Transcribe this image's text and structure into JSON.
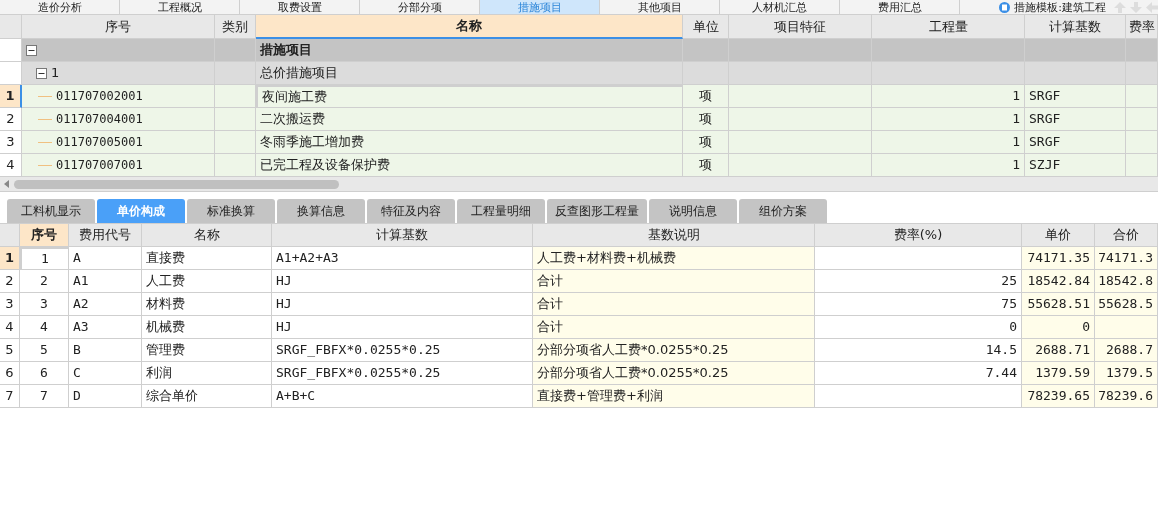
{
  "top_tabs": [
    {
      "label": "造价分析",
      "selected": false
    },
    {
      "label": "工程概况",
      "selected": false
    },
    {
      "label": "取费设置",
      "selected": false
    },
    {
      "label": "分部分项",
      "selected": false
    },
    {
      "label": "措施项目",
      "selected": true
    },
    {
      "label": "其他项目",
      "selected": false
    },
    {
      "label": "人材机汇总",
      "selected": false
    },
    {
      "label": "费用汇总",
      "selected": false
    }
  ],
  "template": "措施模板:建筑工程",
  "upper_table": {
    "columns": [
      {
        "label": "序号",
        "selected": false
      },
      {
        "label": "类别",
        "selected": false
      },
      {
        "label": "名称",
        "selected": true
      },
      {
        "label": "单位",
        "selected": false
      },
      {
        "label": "项目特征",
        "selected": false
      },
      {
        "label": "工程量",
        "selected": false
      },
      {
        "label": "计算基数",
        "selected": false
      },
      {
        "label": "费率",
        "selected": false
      }
    ],
    "rows": [
      {
        "name": "措施项目",
        "expanded": true,
        "children": [
          {
            "code": "1",
            "name": "总价措施项目",
            "expanded": true,
            "children": [
              {
                "row_number": "1",
                "code": "011707002001",
                "name": "夜间施工费",
                "unit": "项",
                "quantity": "1",
                "base": "SRGF",
                "selected": true
              },
              {
                "row_number": "2",
                "code": "011707004001",
                "name": "二次搬运费",
                "unit": "项",
                "quantity": "1",
                "base": "SRGF",
                "selected": false
              },
              {
                "row_number": "3",
                "code": "011707005001",
                "name": "冬雨季施工增加费",
                "unit": "项",
                "quantity": "1",
                "base": "SRGF",
                "selected": false
              },
              {
                "row_number": "4",
                "code": "011707007001",
                "name": "已完工程及设备保护费",
                "unit": "项",
                "quantity": "1",
                "base": "SZJF",
                "selected": false
              }
            ]
          }
        ]
      }
    ]
  },
  "bottom_tabs": [
    {
      "label": "工料机显示",
      "selected": false
    },
    {
      "label": "单价构成",
      "selected": true
    },
    {
      "label": "标准换算",
      "selected": false
    },
    {
      "label": "换算信息",
      "selected": false
    },
    {
      "label": "特征及内容",
      "selected": false
    },
    {
      "label": "工程量明细",
      "selected": false
    },
    {
      "label": "反查图形工程量",
      "selected": false
    },
    {
      "label": "说明信息",
      "selected": false
    },
    {
      "label": "组价方案",
      "selected": false
    }
  ],
  "lower_table": {
    "columns": [
      {
        "label": "序号",
        "selected": true
      },
      {
        "label": "费用代号",
        "selected": false
      },
      {
        "label": "名称",
        "selected": false
      },
      {
        "label": "计算基数",
        "selected": false
      },
      {
        "label": "基数说明",
        "selected": false
      },
      {
        "label": "费率(%)",
        "selected": false
      },
      {
        "label": "单价",
        "selected": false
      },
      {
        "label": "合价",
        "selected": false
      }
    ],
    "rows": [
      {
        "row_number": "1",
        "seq": "1",
        "code": "A",
        "name": "直接费",
        "base": "A1+A2+A3",
        "description": "人工费+材料费+机械费",
        "rate": "",
        "unit_price": "74171.35",
        "total": "74171.3",
        "selected": true
      },
      {
        "row_number": "2",
        "seq": "2",
        "code": "A1",
        "name": "人工费",
        "base": "HJ",
        "description": "合计",
        "rate": "25",
        "unit_price": "18542.84",
        "total": "18542.8",
        "selected": false
      },
      {
        "row_number": "3",
        "seq": "3",
        "code": "A2",
        "name": "材料费",
        "base": "HJ",
        "description": "合计",
        "rate": "75",
        "unit_price": "55628.51",
        "total": "55628.5",
        "selected": false
      },
      {
        "row_number": "4",
        "seq": "4",
        "code": "A3",
        "name": "机械费",
        "base": "HJ",
        "description": "合计",
        "rate": "0",
        "unit_price": "0",
        "total": "",
        "selected": false
      },
      {
        "row_number": "5",
        "seq": "5",
        "code": "B",
        "name": "管理费",
        "base": "SRGF_FBFX*0.0255*0.25",
        "description": "分部分项省人工费*0.0255*0.25",
        "rate": "14.5",
        "unit_price": "2688.71",
        "total": "2688.7",
        "selected": false
      },
      {
        "row_number": "6",
        "seq": "6",
        "code": "C",
        "name": "利润",
        "base": "SRGF_FBFX*0.0255*0.25",
        "description": "分部分项省人工费*0.0255*0.25",
        "rate": "7.44",
        "unit_price": "1379.59",
        "total": "1379.5",
        "selected": false
      },
      {
        "row_number": "7",
        "seq": "7",
        "code": "D",
        "name": "综合单价",
        "base": "A+B+C",
        "description": "直接费+管理费+利润",
        "rate": "",
        "unit_price": "78239.65",
        "total": "78239.6",
        "selected": false
      }
    ]
  }
}
